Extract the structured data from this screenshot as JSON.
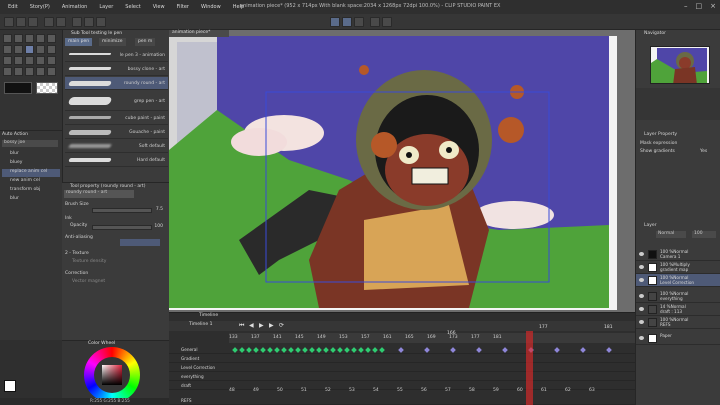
{
  "window": {
    "title": "animation piece* (952 x 714px With blank space:2034 x 1268px 72dpi 100.0%) - CLIP STUDIO PAINT EX"
  },
  "menu": [
    "Edit",
    "Story(P)",
    "Animation",
    "Layer",
    "Select",
    "View",
    "Filter",
    "Window",
    "Help"
  ],
  "subtool": {
    "header": "Sub Tool testing le pen",
    "tabs": [
      "main pen",
      "minimize",
      "pen m"
    ],
    "brushes": [
      "le pen 3 - animation",
      "bossy clone - art",
      "roundy round - art",
      "grep pen - art",
      "cube paint - paint",
      "Gouache - paint",
      "Soft default",
      "Hard default"
    ],
    "selected_index": 2
  },
  "auto_action": {
    "header": "Auto Action",
    "set": "bossy joe",
    "items": [
      "blur",
      "bluey",
      "replace anim cel",
      "new anim cel",
      "transform obj",
      "blur"
    ],
    "selected_index": 2
  },
  "tool_property": {
    "header": "Tool property (roundy round - art)",
    "brush_name": "roundy round - art",
    "brush_size_label": "Brush Size",
    "brush_size_value": "7.5",
    "ink_label": "Ink",
    "opacity_label": "Opacity",
    "opacity_value": "100",
    "anti_alias_label": "Anti-aliasing",
    "texture_label": "2 - Texture",
    "texture_value": "Texture density",
    "correction_label": "Correction",
    "vector_magnet": "Vector magnet"
  },
  "color": {
    "header": "Color Wheel",
    "main": "#ffffff",
    "readout": "R:255 G:255 B:255"
  },
  "canvas": {
    "tab_label": "animation piece*"
  },
  "navigator": {
    "header": "Navigator"
  },
  "layer_property": {
    "header": "Layer Property",
    "mask_label": "Mask expression",
    "gradient_label": "Show gradients",
    "gradient_value": "Yes"
  },
  "layers": {
    "header": "Layer",
    "blend": "Normal",
    "opacity": "100",
    "rows": [
      {
        "name": "100 %Normal\nCamera 1"
      },
      {
        "name": "100 %Multiply\ngradient map"
      },
      {
        "name": "100 %Normal\nLevel Correction"
      },
      {
        "name": "100 %Normal\neverything"
      },
      {
        "name": "14 %Normal\ndraft : 113"
      },
      {
        "name": "100 %Normal\nREFS"
      },
      {
        "name": "Paper"
      }
    ],
    "selected_index": 2
  },
  "timeline": {
    "header": "Timeline",
    "name": "Timeline 1",
    "frame_numbers": [
      "133",
      "137",
      "141",
      "145",
      "149",
      "153",
      "157",
      "161",
      "165",
      "169",
      "173",
      "177",
      "181"
    ],
    "top_marks": [
      "166",
      "177",
      "181"
    ],
    "tracks": [
      "General",
      "Gradient",
      "Level Correction",
      "everything",
      "draft",
      "REFS"
    ],
    "bottom_numbers": [
      "48",
      "49",
      "50",
      "51",
      "52",
      "53",
      "54",
      "55",
      "56",
      "57",
      "58",
      "59",
      "60",
      "61",
      "62",
      "63"
    ],
    "keyframe_color": "#2ecc71"
  },
  "status": {
    "zoom": "100.0"
  }
}
